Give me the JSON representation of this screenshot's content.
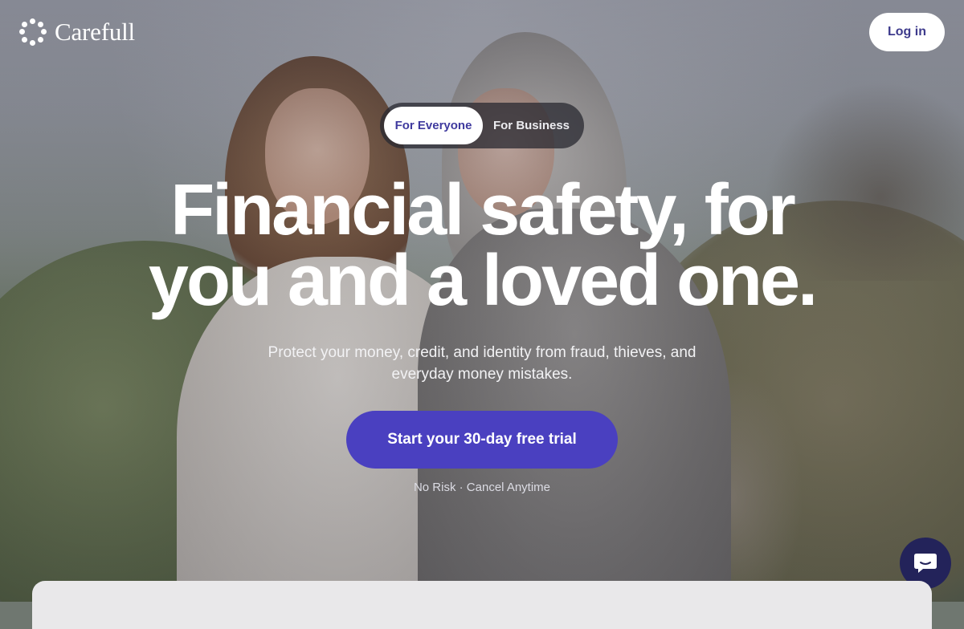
{
  "brand": {
    "name": "Carefull"
  },
  "header": {
    "login_label": "Log in"
  },
  "audience_toggle": {
    "options": [
      "For Everyone",
      "For Business"
    ],
    "selected": "For Everyone"
  },
  "hero": {
    "headline_line1": "Financial safety, for",
    "headline_line2": "you and a loved one.",
    "subheadline": "Protect your money, credit, and identity from fraud, thieves, and everyday money mistakes.",
    "cta_label": "Start your 30-day free trial",
    "note": "No Risk · Cancel Anytime"
  },
  "colors": {
    "accent": "#4a40c0",
    "chat_button": "#23235a",
    "toggle_active_text": "#3f3a9e"
  },
  "icons": {
    "chat": "chat-bubble-icon",
    "logo": "dot-ring-logo-icon"
  }
}
